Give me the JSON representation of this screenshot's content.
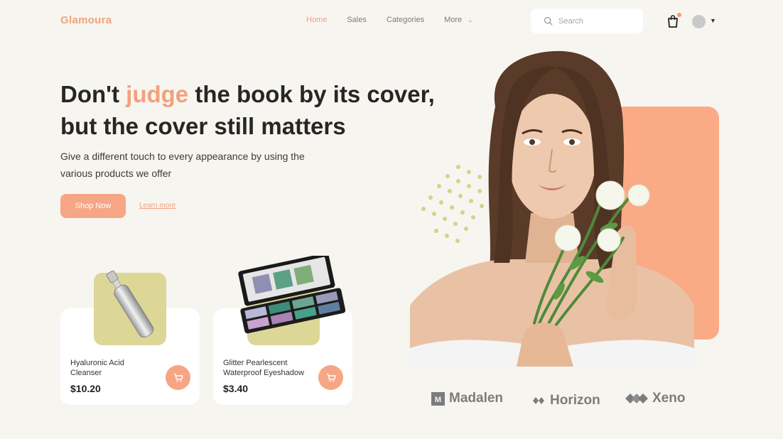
{
  "header": {
    "logo": "Glamoura",
    "nav": [
      {
        "label": "Home",
        "active": true
      },
      {
        "label": "Sales",
        "active": false
      },
      {
        "label": "Categories",
        "active": false
      },
      {
        "label": "More",
        "active": false
      }
    ],
    "search_placeholder": "Search"
  },
  "hero": {
    "headline_pre": "Don't ",
    "headline_accent": "judge",
    "headline_post": " the book by its cover, but the cover still matters",
    "subtext": "Give a different touch to every appearance by using the various products we offer",
    "shop_button": "Shop Now",
    "learn_more": "Learn more"
  },
  "products": [
    {
      "name": "Hyaluronic Acid Cleanser",
      "price": "$10.20"
    },
    {
      "name": "Glitter Pearlescent Waterproof Eyeshadow",
      "price": "$3.40"
    }
  ],
  "brands": [
    {
      "name": "Madalen",
      "icon": "m-square-icon"
    },
    {
      "name": "Horizon",
      "icon": "diamond-pair-icon"
    },
    {
      "name": "Xeno",
      "icon": "triple-diamond-icon"
    }
  ],
  "colors": {
    "accent": "#f2a17e",
    "button": "#f6a685",
    "product_bg": "#dcd797",
    "background": "#f7f5ef",
    "orange_block": "#fbaa86"
  }
}
